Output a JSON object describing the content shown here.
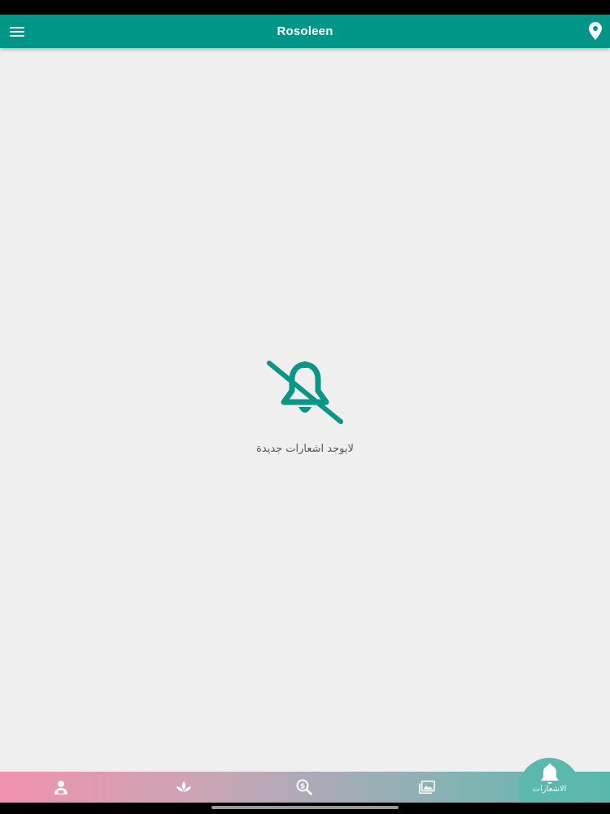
{
  "app_bar": {
    "title": "Rosoleen",
    "menu_icon": "hamburger-menu-icon",
    "location_icon": "map-pin-icon"
  },
  "empty_state": {
    "icon": "notifications-off-icon",
    "message": "لايوجد اشعارات جديدة"
  },
  "bottom_nav": {
    "items": [
      {
        "icon": "profile-icon"
      },
      {
        "icon": "lotus-icon"
      },
      {
        "icon": "search-money-icon"
      },
      {
        "icon": "gallery-icon"
      },
      {
        "icon": "bell-icon",
        "label": "الاشعارات",
        "active": true
      }
    ]
  },
  "colors": {
    "primary": "#009687",
    "background": "#efefef",
    "nav_gradient_start": "#f191ad",
    "nav_gradient_end": "#57b7ab"
  }
}
